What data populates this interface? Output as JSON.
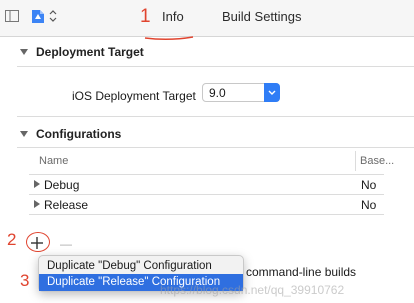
{
  "tabs": [
    {
      "label": "Info"
    },
    {
      "label": "Build Settings"
    }
  ],
  "annotations": {
    "mark_1": "1",
    "mark_2": "2",
    "mark_3": "3"
  },
  "deployment": {
    "section_title": "Deployment Target",
    "field_label": "iOS Deployment Target",
    "field_value": "9.0"
  },
  "configurations": {
    "section_title": "Configurations",
    "columns": {
      "name": "Name",
      "base": "Base..."
    },
    "rows": [
      {
        "name": "Debug",
        "base": "No"
      },
      {
        "name": "Release",
        "base": "No"
      }
    ]
  },
  "controls": {
    "minus": "—"
  },
  "menu": {
    "items": [
      {
        "label": "Duplicate \"Debug\" Configuration"
      },
      {
        "label": "Duplicate \"Release\" Configuration"
      }
    ]
  },
  "background_text": "command-line builds",
  "watermark": "https://blog.csdn.net/qq_39910762",
  "colors": {
    "accent": "#2f7df6",
    "annotation": "#e0442f",
    "selection": "#2f6fe0"
  }
}
